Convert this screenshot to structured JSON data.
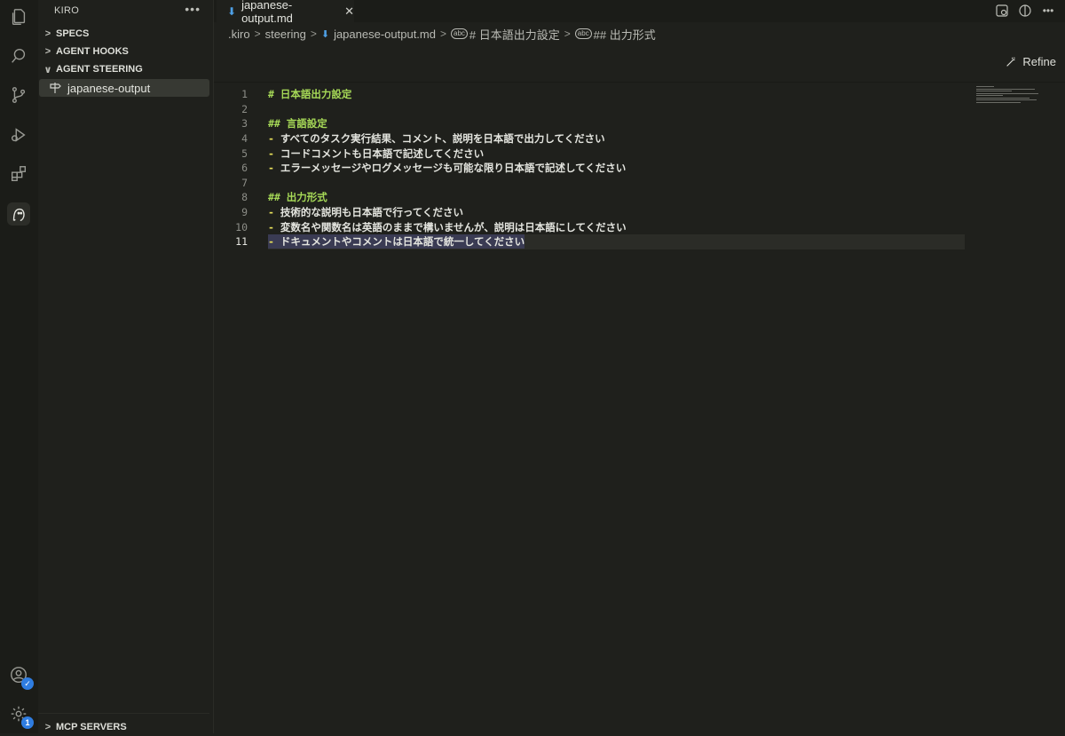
{
  "sidebar": {
    "title": "KIRO",
    "sections": [
      {
        "label": "SPECS",
        "expanded": false
      },
      {
        "label": "AGENT HOOKS",
        "expanded": false
      },
      {
        "label": "AGENT STEERING",
        "expanded": true
      }
    ],
    "steering_items": [
      {
        "label": "japanese-output"
      }
    ],
    "bottom_section": "MCP SERVERS"
  },
  "activity_bar": {
    "icons": [
      "explorer-icon",
      "search-icon",
      "source-control-icon",
      "run-debug-icon",
      "extensions-icon",
      "kiro-ghost-icon",
      "account-icon",
      "settings-icon"
    ],
    "settings_badge": "1"
  },
  "tab": {
    "title": "japanese-output.md",
    "icon": "markdown-icon"
  },
  "breadcrumb": {
    "items": [
      ".kiro",
      "steering",
      "japanese-output.md",
      "# 日本語出力設定",
      "## 出力形式"
    ]
  },
  "toolbar": {
    "refine_label": "Refine"
  },
  "editor": {
    "current_line": 11,
    "lines": [
      {
        "n": "1",
        "marker": "#",
        "text": " 日本語出力設定",
        "kind": "heading"
      },
      {
        "n": "2",
        "marker": "",
        "text": "",
        "kind": "blank"
      },
      {
        "n": "3",
        "marker": "##",
        "text": " 言語設定",
        "kind": "heading"
      },
      {
        "n": "4",
        "marker": "-",
        "text": " すべてのタスク実行結果、コメント、説明を日本語で出力してください",
        "kind": "item"
      },
      {
        "n": "5",
        "marker": "-",
        "text": " コードコメントも日本語で記述してください",
        "kind": "item"
      },
      {
        "n": "6",
        "marker": "-",
        "text": " エラーメッセージやログメッセージも可能な限り日本語で記述してください",
        "kind": "item"
      },
      {
        "n": "7",
        "marker": "",
        "text": "",
        "kind": "blank"
      },
      {
        "n": "8",
        "marker": "##",
        "text": " 出力形式",
        "kind": "heading"
      },
      {
        "n": "9",
        "marker": "-",
        "text": " 技術的な説明も日本語で行ってください",
        "kind": "item"
      },
      {
        "n": "10",
        "marker": "-",
        "text": " 変数名や関数名は英語のままで構いませんが、説明は日本語にしてください",
        "kind": "item"
      },
      {
        "n": "11",
        "marker": "-",
        "text": " ドキュメントやコメントは日本語で統一してください",
        "kind": "item"
      }
    ]
  },
  "colors": {
    "heading": "#a6d957",
    "list_marker": "#e8e05a",
    "accent": "#2f7de1"
  }
}
